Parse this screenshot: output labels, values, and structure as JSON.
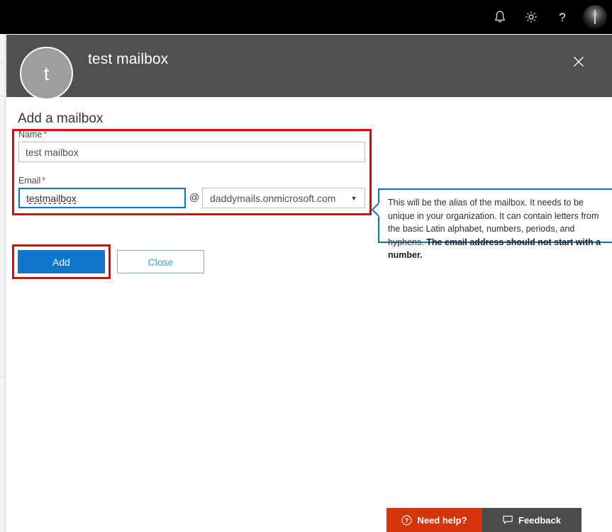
{
  "suitebar": {
    "background": "#000000",
    "icons": [
      {
        "name": "notification-bell-icon",
        "label": "Notifications"
      },
      {
        "name": "gear-icon",
        "label": "Settings"
      },
      {
        "name": "help-question-icon",
        "label": "Help"
      }
    ],
    "avatar": {
      "name": "user-avatar",
      "label": "Account manager"
    }
  },
  "panel": {
    "title": "test mailbox",
    "persona_initial": "t",
    "close_label": "✕",
    "header_background": "#505050"
  },
  "form": {
    "section_title": "Add a mailbox",
    "name": {
      "label": "Name",
      "required_marker": "*",
      "value": "test mailbox",
      "placeholder": "Name"
    },
    "email": {
      "label": "Email",
      "required_marker": "*",
      "alias_value": "testmailbox",
      "alias_placeholder": "Email",
      "at_symbol": "@",
      "domain_selected": "daddymails.onmicrosoft.com",
      "domain_caret": "▼"
    },
    "buttons": {
      "add_label": "Add",
      "close_label": "Close"
    },
    "highlight_color": "#ec0000"
  },
  "callout": {
    "text_part_1": "This will be the alias of the mailbox. It needs to be unique in your organization. It can contain letters from the basic Latin alphabet, numbers, periods, and hyphens. ",
    "text_bold": "The email address should not start with a number.",
    "border_color": "#0a74c4"
  },
  "footer": {
    "need_help_label": "Need help?",
    "need_help_color": "#d6350b",
    "feedback_label": "Feedback",
    "feedback_color": "#4b4b4b"
  }
}
